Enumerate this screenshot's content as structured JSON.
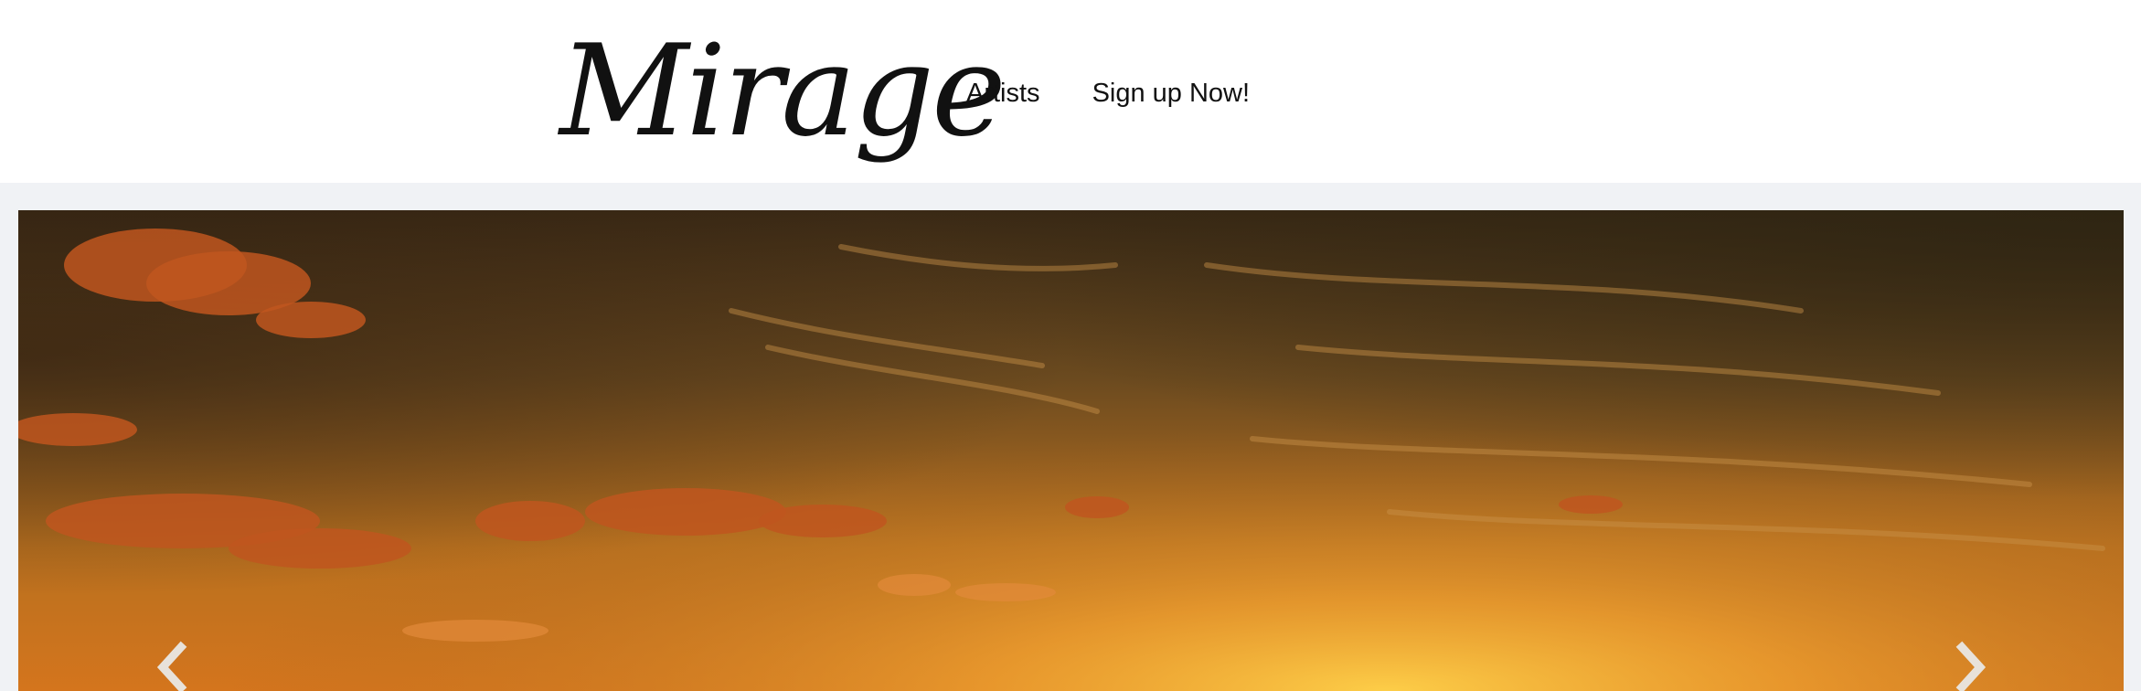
{
  "brand": {
    "logo_text": "Mirage"
  },
  "nav": {
    "items": [
      {
        "label": "Artists"
      },
      {
        "label": "Sign up Now!"
      }
    ]
  },
  "carousel": {
    "prev_icon": "chevron-left-icon",
    "next_icon": "chevron-right-icon",
    "colors": {
      "sky_top": "#3b2a16",
      "sky_mid": "#a8641f",
      "sky_glow": "#f5b93a",
      "cloud": "#c0561f"
    }
  }
}
